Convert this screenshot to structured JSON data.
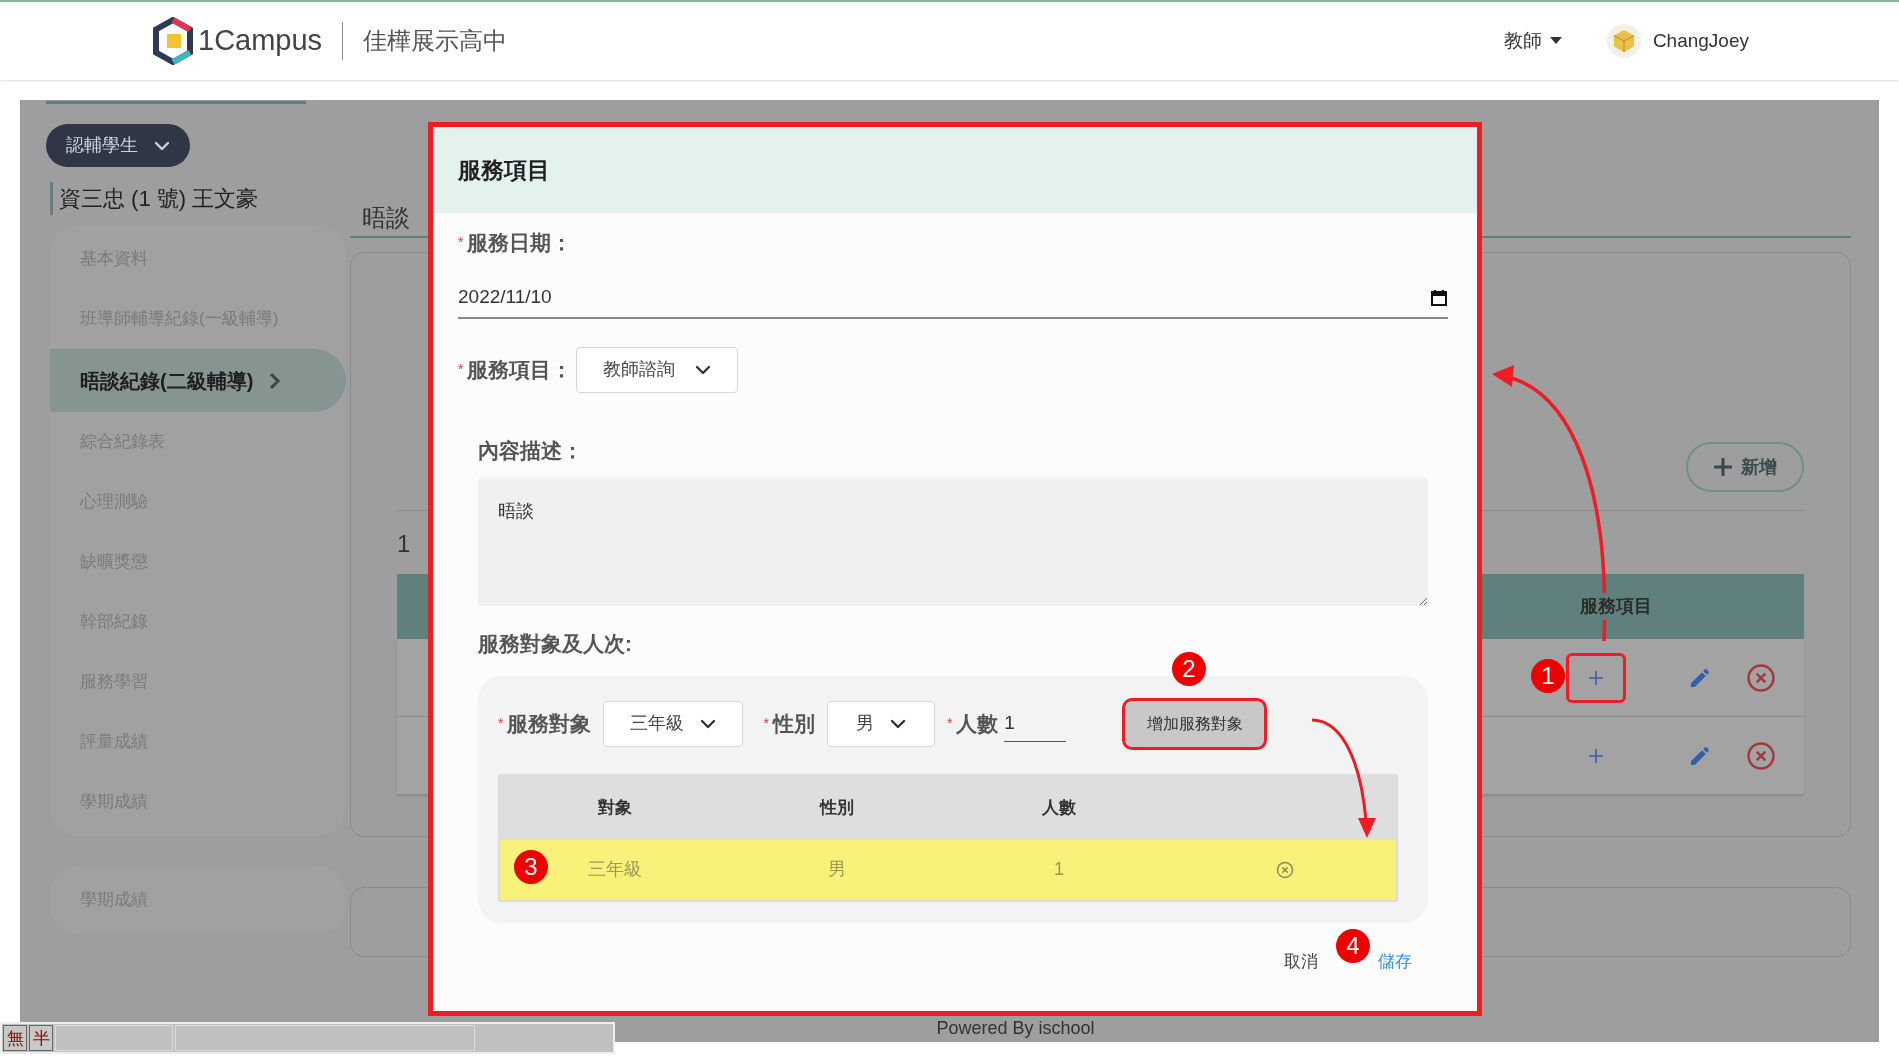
{
  "header": {
    "logo_text": "1Campus",
    "school": "佳樺展示高中",
    "role": "教師",
    "user": "ChangJoey"
  },
  "sidebar": {
    "filter": "認輔學生",
    "student": "資三忠 (1 號) 王文豪",
    "items": [
      {
        "label": "基本資料",
        "selected": false
      },
      {
        "label": "班導師輔導紀錄(一級輔導)",
        "selected": false
      },
      {
        "label": "晤談紀錄(二級輔導)",
        "selected": true
      },
      {
        "label": "綜合紀錄表",
        "selected": false
      },
      {
        "label": "心理測驗",
        "selected": false
      },
      {
        "label": "缺曠獎懲",
        "selected": false
      },
      {
        "label": "幹部紀錄",
        "selected": false
      },
      {
        "label": "服務學習",
        "selected": false
      },
      {
        "label": "評量成績",
        "selected": false
      },
      {
        "label": "學期成績",
        "selected": false
      }
    ],
    "extra_items": [
      "學期成績"
    ]
  },
  "main": {
    "tab": "晤談",
    "count": "1",
    "add_button": "新增",
    "table": {
      "column": "服務項目",
      "rows": [
        {
          "annotated": true
        },
        {
          "annotated": false
        }
      ]
    }
  },
  "footer": "Powered By ischool",
  "ime_bar": [
    "無",
    "半"
  ],
  "modal": {
    "title": "服務項目",
    "date": {
      "required_mark": "*",
      "label": "服務日期：",
      "value": "2022/11/10"
    },
    "item": {
      "required_mark": "*",
      "label": "服務項目：",
      "value": "教師諮詢"
    },
    "description": {
      "label": "內容描述：",
      "value": "晤談"
    },
    "targets_label": "服務對象及人次:",
    "target": {
      "required_mark": "*",
      "label": "服務對象",
      "value": "三年級"
    },
    "gender": {
      "required_mark": "*",
      "label": "性別",
      "value": "男"
    },
    "count": {
      "required_mark": "*",
      "label": "人數",
      "value": "1"
    },
    "add_target": {
      "label": "增加服務對象",
      "annotated": true
    },
    "columns": [
      "對象",
      "性別",
      "人數"
    ],
    "rows": [
      {
        "target": "三年級",
        "gender": "男",
        "count": "1",
        "highlighted": true
      }
    ],
    "cancel": "取消",
    "save": "儲存"
  },
  "steps": [
    "1",
    "2",
    "3",
    "4"
  ]
}
